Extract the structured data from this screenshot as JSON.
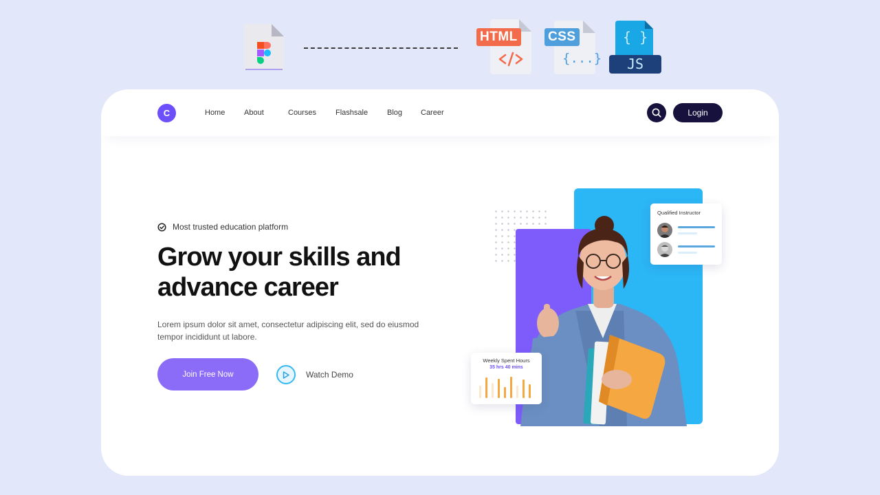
{
  "banner": {
    "from_icon": "figma-file-icon",
    "to_files": [
      {
        "icon": "html-file-icon",
        "tag": "HTML",
        "symbol": "</>",
        "color": "#f26b4b"
      },
      {
        "icon": "css-file-icon",
        "tag": "CSS",
        "symbol": "{...}",
        "color": "#3f9ad8"
      },
      {
        "icon": "js-file-icon",
        "tag": "JS",
        "symbol": "{ }",
        "color": "#1aa7e6"
      }
    ]
  },
  "nav": {
    "logo_letter": "C",
    "items": [
      "Home",
      "About",
      "Courses",
      "Flashsale",
      "Blog",
      "Career"
    ],
    "login_label": "Login"
  },
  "hero": {
    "badge": "Most trusted education platform",
    "title_line1": "Grow your skills and",
    "title_line2": "advance career",
    "description": "Lorem ipsum dolor sit amet, consectetur adipiscing elit, sed do eiusmod tempor incididunt ut labore.",
    "cta_primary": "Join Free Now",
    "cta_secondary": "Watch Demo"
  },
  "instructor_card": {
    "title": "Qualified Instructor"
  },
  "weekly_card": {
    "title": "Weekly Spent Hours",
    "value": "35 hrs 40 mins"
  },
  "colors": {
    "page_bg": "#e2e7f9",
    "accent_purple": "#7d5cfb",
    "accent_blue": "#2bb6f6",
    "button_primary": "#8b6cf8",
    "navy": "#16123d",
    "chart_orange": "#f5a742"
  }
}
